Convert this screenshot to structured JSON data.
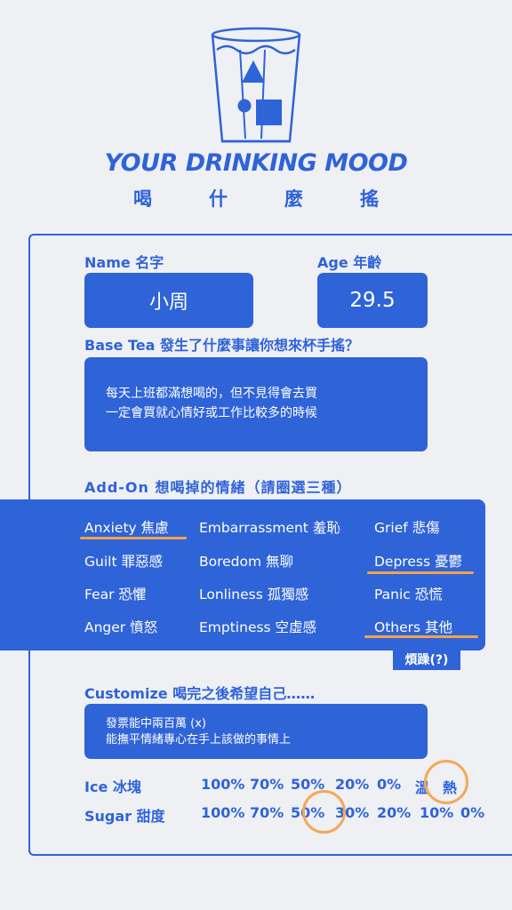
{
  "header": {
    "title": "YOUR DRINKING MOOD",
    "subtitle": "喝什麼搖"
  },
  "form": {
    "name_label": "Name 名字",
    "name_value": "小周",
    "age_label": "Age 年齡",
    "age_value": "29.5",
    "basetea_label": "Base Tea 發生了什麼事讓你想來杯手搖？",
    "basetea_lines": [
      "每天上班都滿想喝的，但不見得會去買",
      "一定會買就心情好或工作比較多的時候"
    ],
    "addon_label": "Add-On 想喝掉的情緒（請圈選三種）",
    "emotions": [
      [
        "Anxiety 焦慮",
        "Embarrassment 羞恥",
        "Grief 悲傷"
      ],
      [
        "Guilt 罪惡感",
        "Boredom 無聊",
        "Depress 憂鬱"
      ],
      [
        "Fear 恐懼",
        "Lonliness 孤獨感",
        "Panic 恐慌"
      ],
      [
        "Anger 憤怒",
        "Emptiness 空虛感",
        "Others 其他"
      ]
    ],
    "selected_emotions": [
      "Anxiety 焦慮",
      "Depress 憂鬱",
      "Others 其他"
    ],
    "others_note": "煩躁(?)",
    "customize_label": "Customize 喝完之後希望自己……",
    "customize_lines": [
      "發票能中兩百萬 (x)",
      "能撫平情緒專心在手上該做的事情上"
    ],
    "ice_label": "Ice 冰塊",
    "ice_options": [
      "100%",
      "70%",
      "50%",
      "20%",
      "0%",
      "溫",
      "熱"
    ],
    "ice_selected": "熱",
    "sugar_label": "Sugar 甜度",
    "sugar_options": [
      "100%",
      "70%",
      "50%",
      "30%",
      "20%",
      "10%",
      "0%"
    ],
    "sugar_selected": "50%"
  },
  "colors": {
    "accent": "#2f63d8",
    "highlight": "#f4a24b",
    "background": "#eef0f4"
  }
}
